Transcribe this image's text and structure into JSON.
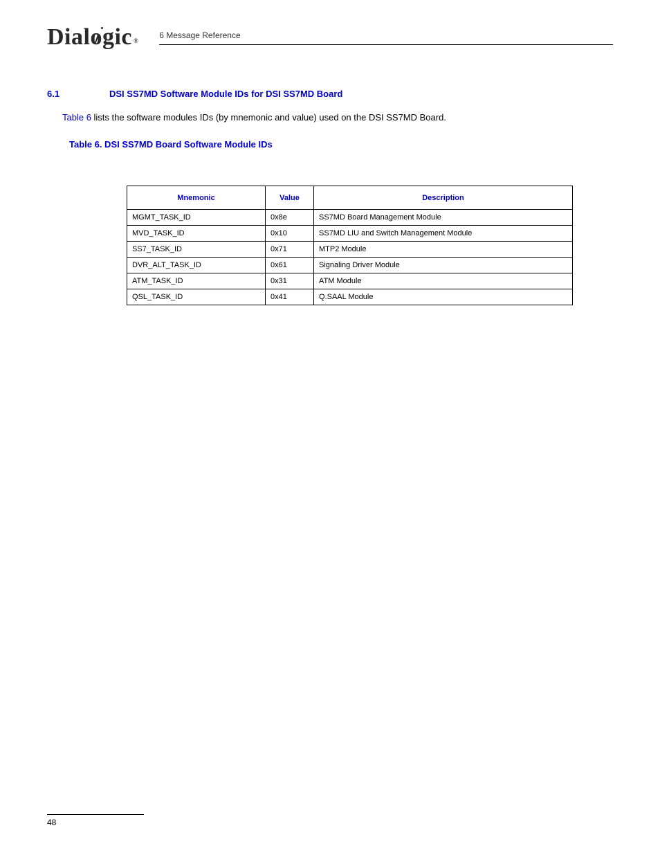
{
  "header": {
    "logo_text_pre": "Dial",
    "logo_text_o": "o",
    "logo_text_post": "gic",
    "logo_reg": "®",
    "chapter": "6 Message Reference"
  },
  "section": {
    "number": "6.1",
    "title": "DSI SS7MD Software Module IDs for DSI SS7MD Board"
  },
  "paragraph": {
    "ref": "Table 6",
    "text_after": " lists the software modules IDs (by mnemonic and value) used on the DSI SS7MD Board."
  },
  "table_caption": "Table 6.  DSI SS7MD Board Software Module IDs",
  "table": {
    "headers": {
      "mnemonic": "Mnemonic",
      "value": "Value",
      "description": "Description"
    },
    "rows": [
      {
        "mnemonic": "MGMT_TASK_ID",
        "value": "0x8e",
        "description": "SS7MD Board Management Module"
      },
      {
        "mnemonic": "MVD_TASK_ID",
        "value": "0x10",
        "description": "SS7MD LIU and Switch Management Module"
      },
      {
        "mnemonic": "SS7_TASK_ID",
        "value": "0x71",
        "description": "MTP2 Module"
      },
      {
        "mnemonic": "DVR_ALT_TASK_ID",
        "value": "0x61",
        "description": "Signaling Driver Module"
      },
      {
        "mnemonic": "ATM_TASK_ID",
        "value": "0x31",
        "description": "ATM Module"
      },
      {
        "mnemonic": "QSL_TASK_ID",
        "value": "0x41",
        "description": "Q.SAAL Module"
      }
    ]
  },
  "footer": {
    "page": "48"
  }
}
